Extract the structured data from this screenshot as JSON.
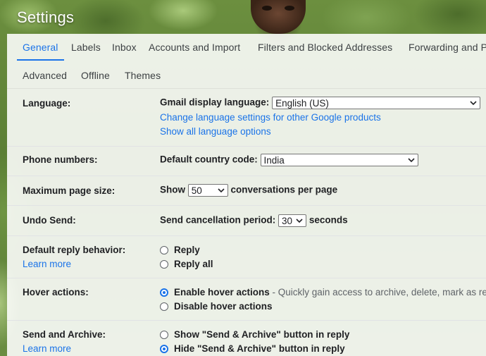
{
  "header": {
    "title": "Settings"
  },
  "tabs": {
    "row1": [
      {
        "label": "General",
        "active": true
      },
      {
        "label": "Labels"
      },
      {
        "label": "Inbox"
      },
      {
        "label": "Accounts and Import"
      },
      {
        "label": "Filters and Blocked Addresses"
      },
      {
        "label": "Forwarding and POP/IMAP"
      }
    ],
    "row2": [
      {
        "label": "Advanced"
      },
      {
        "label": "Offline"
      },
      {
        "label": "Themes"
      }
    ]
  },
  "language": {
    "label": "Language:",
    "display_label": "Gmail display language:",
    "display_value": "English (US)",
    "link_change": "Change language settings for other Google products",
    "link_show_all": "Show all language options"
  },
  "phone": {
    "label": "Phone numbers:",
    "country_label": "Default country code:",
    "country_value": "India"
  },
  "page_size": {
    "label": "Maximum page size:",
    "prefix": "Show",
    "value": "50",
    "suffix": "conversations per page"
  },
  "undo_send": {
    "label": "Undo Send:",
    "prefix": "Send cancellation period:",
    "value": "30",
    "suffix": "seconds"
  },
  "reply": {
    "label": "Default reply behavior:",
    "learn_more": "Learn more",
    "options": [
      {
        "label": "Reply",
        "checked": false
      },
      {
        "label": "Reply all",
        "checked": false
      }
    ]
  },
  "hover": {
    "label": "Hover actions:",
    "options": [
      {
        "label": "Enable hover actions",
        "desc": " - Quickly gain access to archive, delete, mark as read",
        "checked": true
      },
      {
        "label": "Disable hover actions",
        "checked": false
      }
    ]
  },
  "send_archive": {
    "label": "Send and Archive:",
    "learn_more": "Learn more",
    "options": [
      {
        "label": "Show \"Send & Archive\" button in reply",
        "checked": false
      },
      {
        "label": "Hide \"Send & Archive\" button in reply",
        "checked": true
      }
    ]
  },
  "colors": {
    "accent": "#1a73e8",
    "text": "#202124",
    "muted": "#5f6368"
  }
}
